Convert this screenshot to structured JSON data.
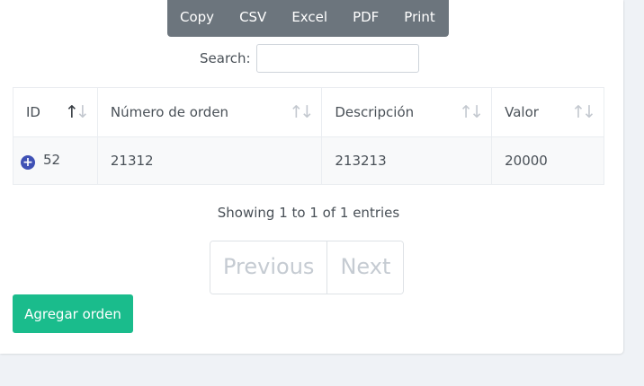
{
  "buttons": {
    "copy": "Copy",
    "csv": "CSV",
    "excel": "Excel",
    "pdf": "PDF",
    "print": "Print"
  },
  "search": {
    "label": "Search:",
    "value": ""
  },
  "table": {
    "headers": [
      "ID",
      "Número de orden",
      "Descripción",
      "Valor"
    ],
    "rows": [
      {
        "id": "52",
        "numero": "21312",
        "descripcion": "213213",
        "valor": "20000"
      }
    ]
  },
  "info": "Showing 1 to 1 of 1 entries",
  "pagination": {
    "previous": "Previous",
    "next": "Next"
  },
  "actions": {
    "add_order": "Agregar orden"
  },
  "colors": {
    "accent": "#1abc8c",
    "buttonbar": "#6c757d",
    "expand": "#3f51b5"
  }
}
